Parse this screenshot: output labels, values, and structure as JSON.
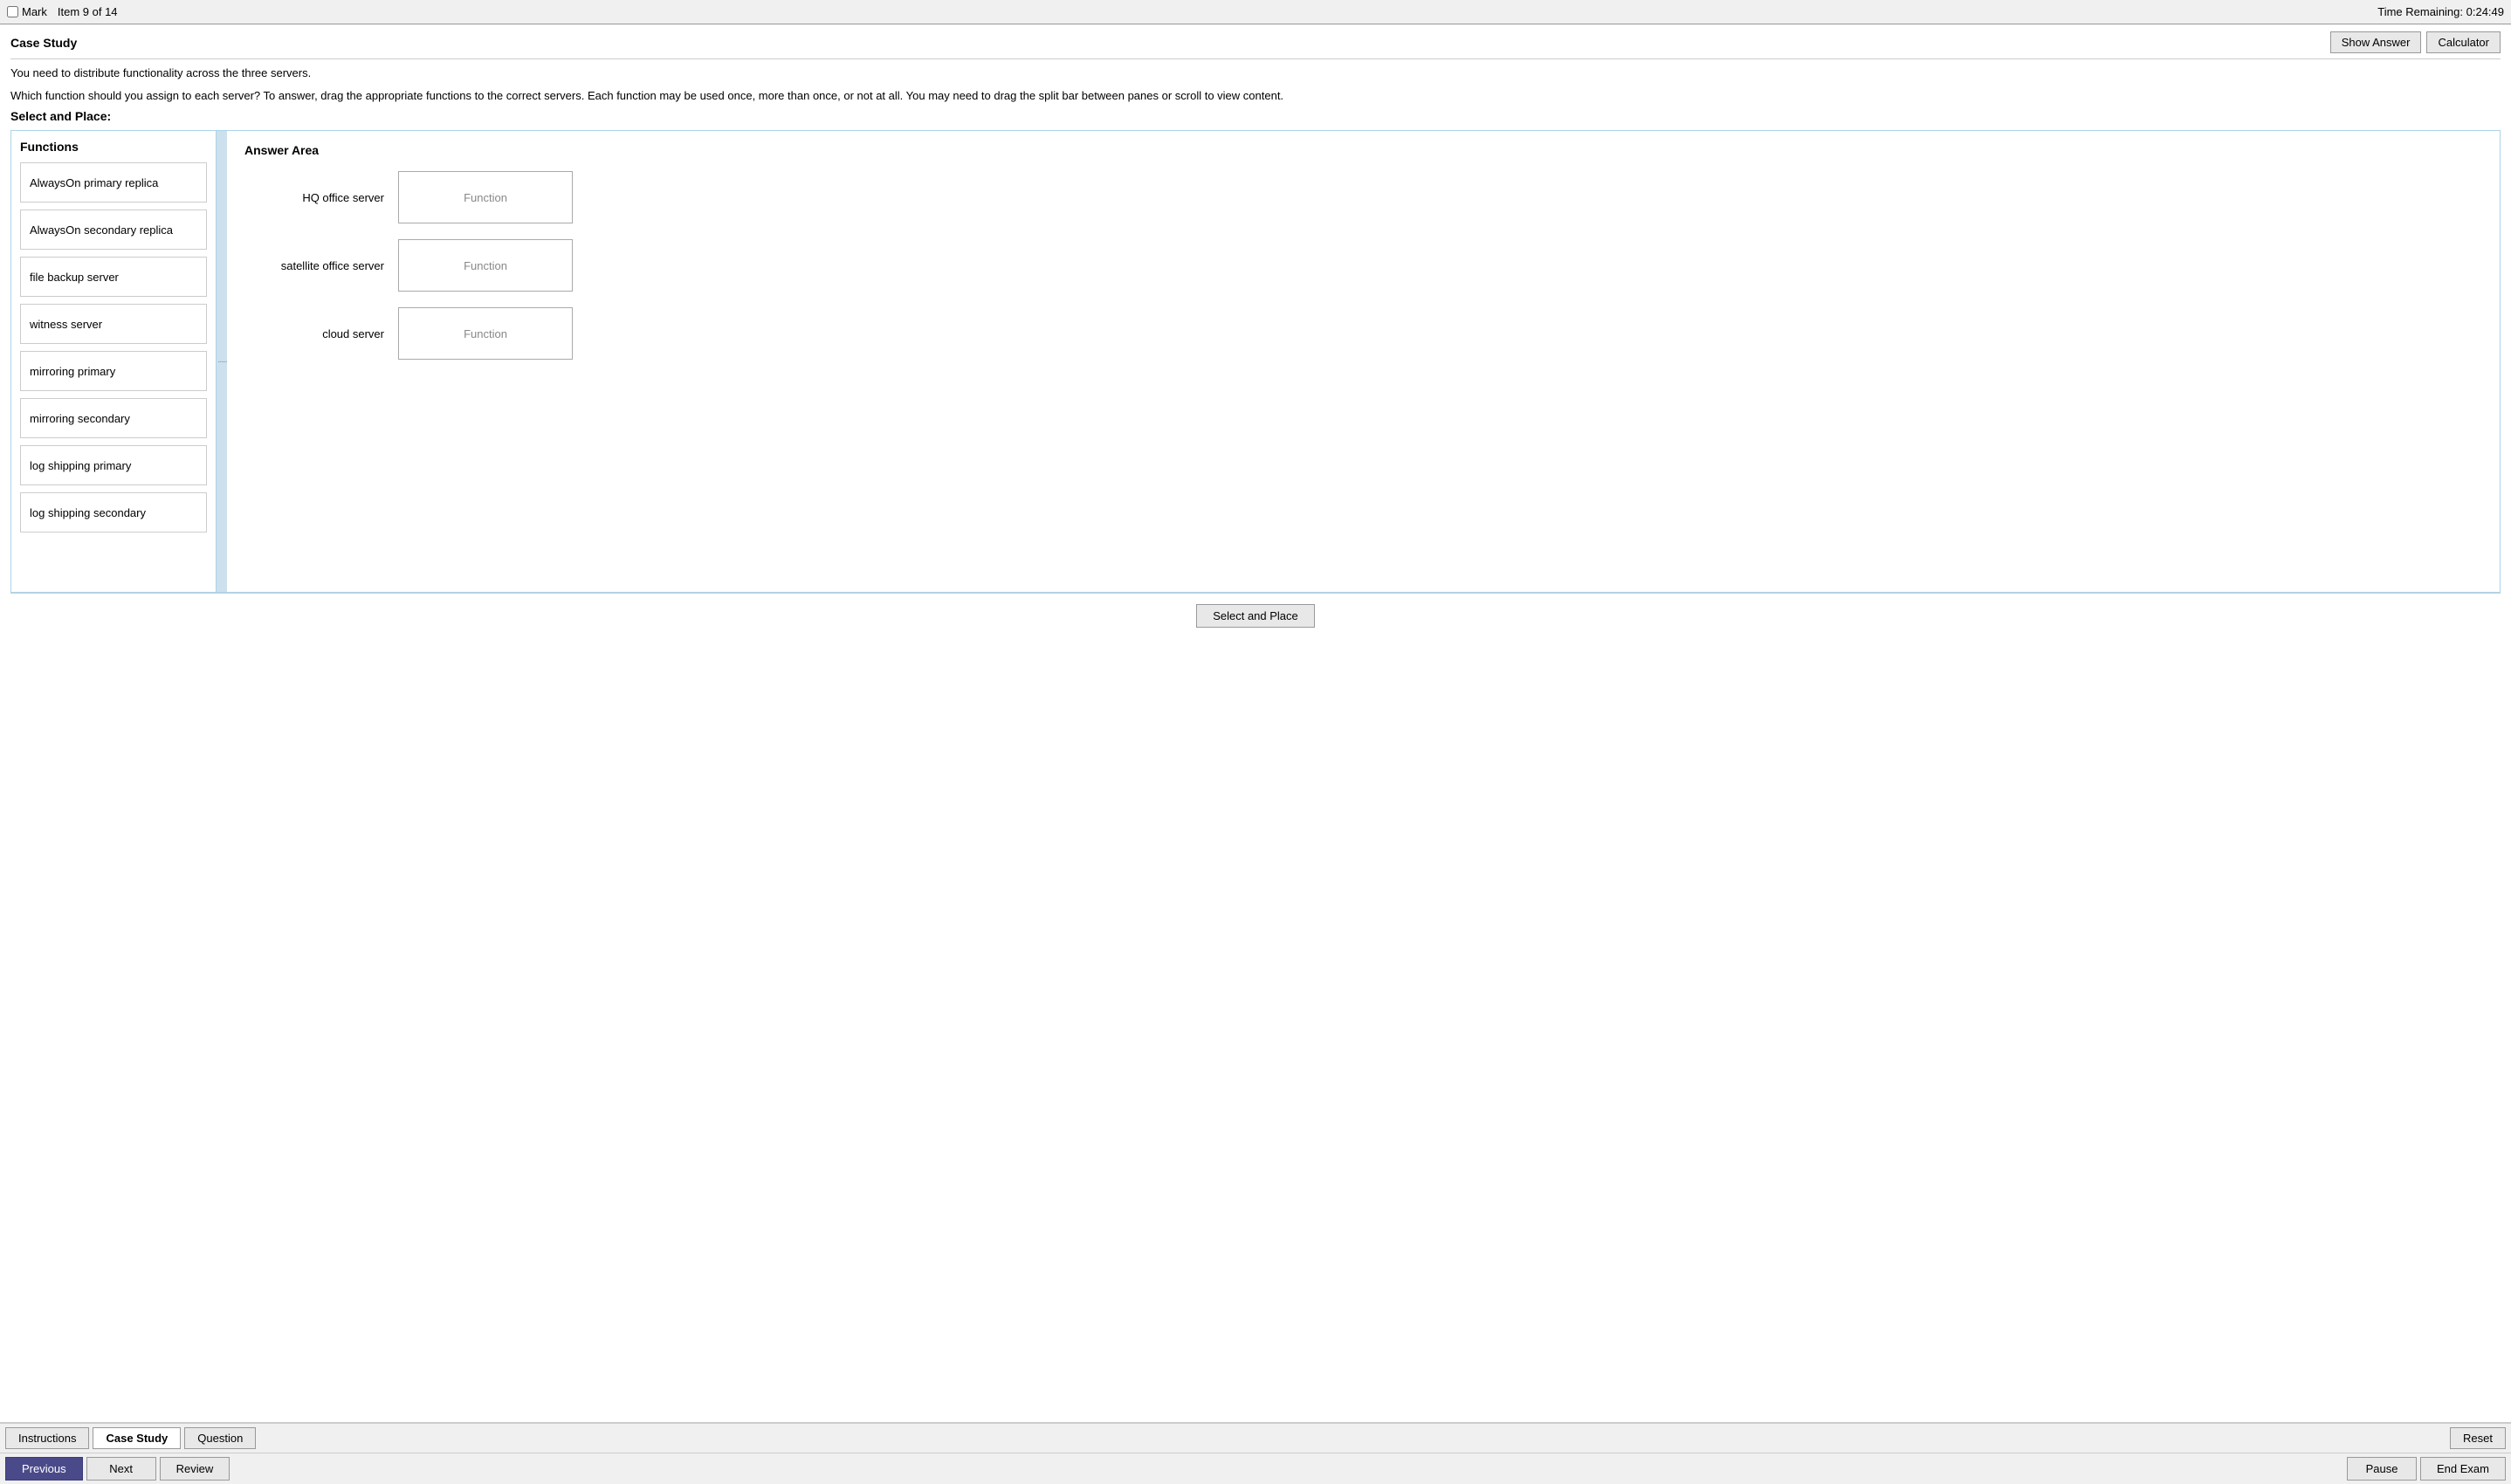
{
  "topbar": {
    "mark_label": "Mark",
    "item_info": "Item 9 of 14",
    "time_remaining": "Time Remaining: 0:24:49"
  },
  "header": {
    "case_study_label": "Case Study",
    "show_answer_label": "Show Answer",
    "calculator_label": "Calculator"
  },
  "question": {
    "line1": "You need to distribute functionality across the three servers.",
    "line2": "Which function should you assign to each server? To answer, drag the appropriate functions to the correct servers. Each function may be used once, more than once, or not at all. You may need to drag the split bar between panes or scroll to view content."
  },
  "select_place": {
    "label": "Select and Place:",
    "button_label": "Select and Place"
  },
  "functions_panel": {
    "title": "Functions",
    "items": [
      "AlwaysOn primary replica",
      "AlwaysOn secondary replica",
      "file backup server",
      "witness server",
      "mirroring primary",
      "mirroring secondary",
      "log shipping primary",
      "log shipping secondary"
    ]
  },
  "answer_panel": {
    "title": "Answer Area",
    "rows": [
      {
        "server": "HQ office server",
        "placeholder": "Function"
      },
      {
        "server": "satellite office server",
        "placeholder": "Function"
      },
      {
        "server": "cloud server",
        "placeholder": "Function"
      }
    ]
  },
  "nav": {
    "tabs": [
      {
        "label": "Instructions",
        "active": false
      },
      {
        "label": "Case Study",
        "active": true
      },
      {
        "label": "Question",
        "active": false
      }
    ],
    "reset_label": "Reset",
    "previous_label": "Previous",
    "next_label": "Next",
    "review_label": "Review",
    "pause_label": "Pause",
    "end_exam_label": "End Exam"
  }
}
